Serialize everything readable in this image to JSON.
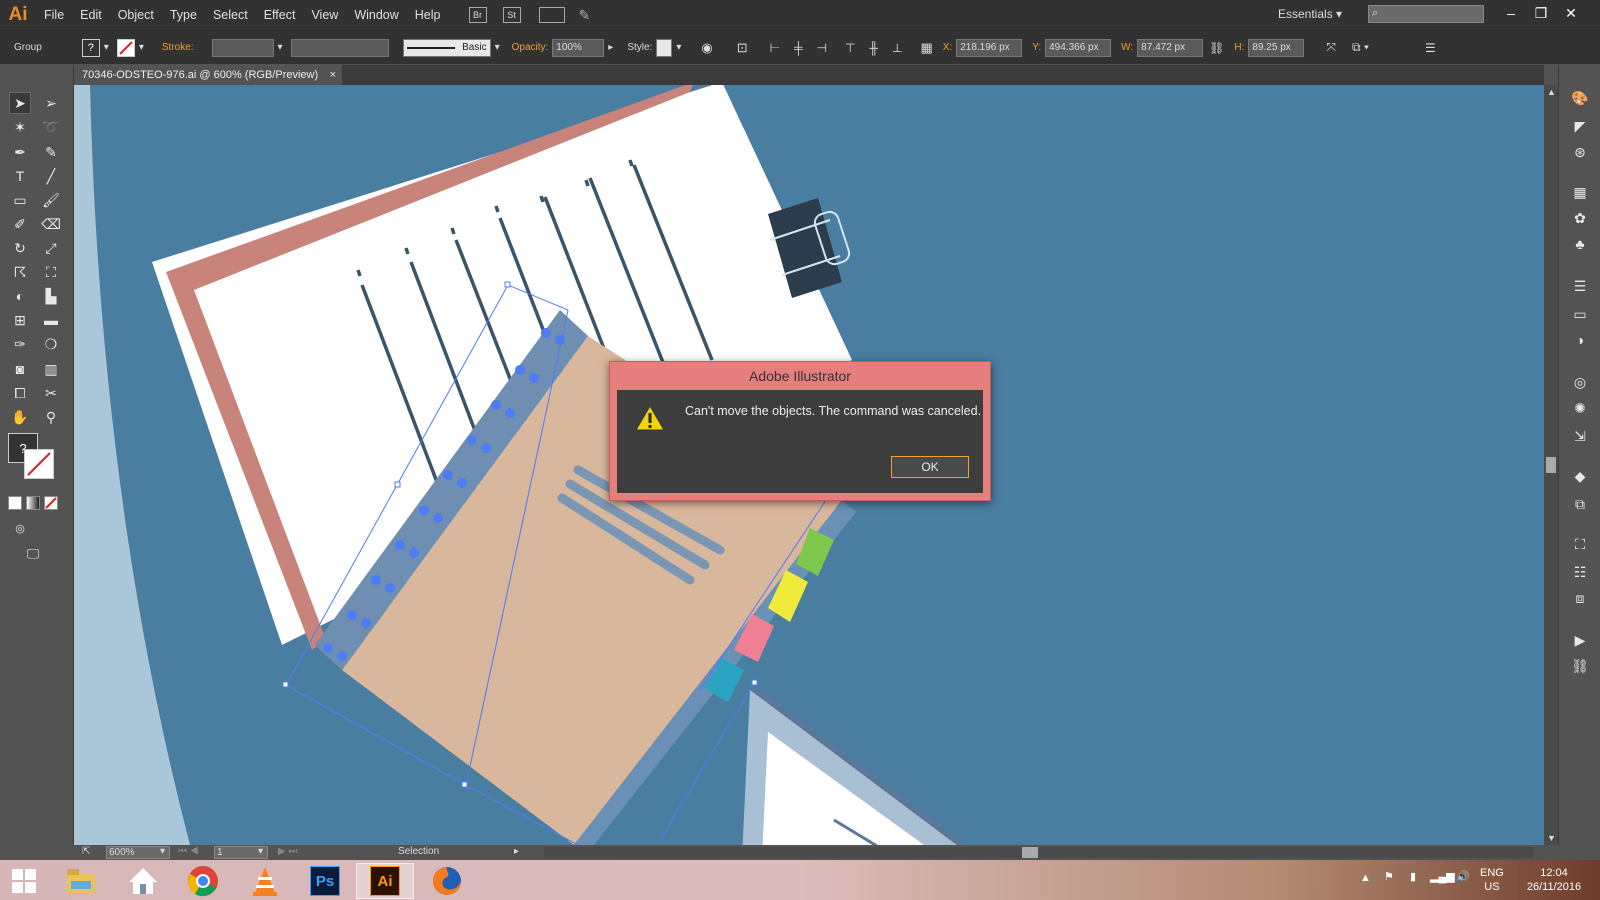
{
  "app": {
    "logo": "Ai"
  },
  "menu": [
    "File",
    "Edit",
    "Object",
    "Type",
    "Select",
    "Effect",
    "View",
    "Window",
    "Help"
  ],
  "menu_buttons": {
    "bridge": "Br",
    "stock": "St"
  },
  "workspace": "Essentials",
  "control": {
    "selection_type": "Group",
    "fill_label": "?",
    "stroke_label": "Stroke:",
    "brush_label": "Basic",
    "opacity_label": "Opacity:",
    "opacity_value": "100%",
    "style_label": "Style:",
    "x_label": "X:",
    "x_value": "218.196 px",
    "y_label": "Y:",
    "y_value": "494.366 px",
    "w_label": "W:",
    "w_value": "87.472 px",
    "h_label": "H:",
    "h_value": "89.25 px"
  },
  "document_tab": {
    "title": "70346-ODSTEO-976.ai @ 600% (RGB/Preview)",
    "close": "×"
  },
  "status": {
    "zoom": "600%",
    "artboard": "1",
    "tool": "Selection"
  },
  "dialog": {
    "title": "Adobe Illustrator",
    "message": "Can't move the objects. The command was canceled.",
    "ok": "OK"
  },
  "taskbar": {
    "apps": [
      {
        "name": "file-explorer"
      },
      {
        "name": "home"
      },
      {
        "name": "chrome"
      },
      {
        "name": "vlc"
      },
      {
        "name": "photoshop",
        "label": "Ps"
      },
      {
        "name": "illustrator",
        "label": "Ai"
      },
      {
        "name": "firefox"
      }
    ],
    "lang": "ENG",
    "locale": "US",
    "time": "12:04",
    "date": "26/11/2016"
  },
  "colors": {
    "canvas_bg": "#4a7ea1",
    "accent": "#f0a030",
    "dialog_frame": "#e77e7e",
    "notebook": "#d9b79c",
    "paper_border": "#c8837a",
    "selection": "#4d7cf5"
  }
}
